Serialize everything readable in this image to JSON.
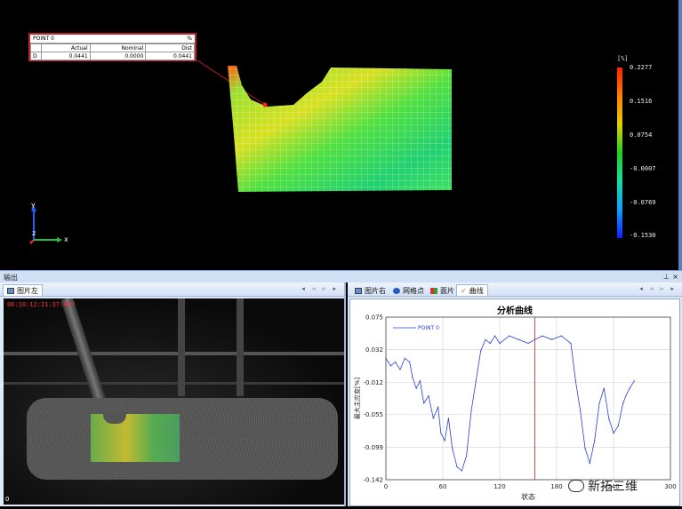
{
  "viewport": {
    "point_box": {
      "title": "POINT 0",
      "unit": "%",
      "headers": [
        "Actual",
        "Nominal",
        "Dist"
      ],
      "row_label": "D",
      "values": [
        "0.0441",
        "0.0000",
        "0.0441"
      ]
    },
    "scale": {
      "unit": "[%]",
      "ticks": [
        "0.2277",
        "0.1516",
        "0.0754",
        "-0.0007",
        "-0.0769",
        "-0.1530"
      ]
    },
    "axes": {
      "x": "x",
      "y": "y",
      "z": "z"
    }
  },
  "output_bar": {
    "title": "输出",
    "pin": "⊥",
    "close": "×"
  },
  "left_panel": {
    "tab": "图片左",
    "timestamp": "06:10:12:21:37:487",
    "frame_index": "0",
    "nav": "◂ ◃ ▹ ▸"
  },
  "right_panel": {
    "tabs": [
      "图片右",
      "网格点",
      "面片",
      "曲线"
    ],
    "nav": "◂ ◃ ▹ ▸",
    "watermark": "新拓三维"
  },
  "chart_data": {
    "type": "line",
    "title": "分析曲线",
    "xlabel": "状态",
    "ylabel": "最大主应变[%]",
    "xlim": [
      0,
      300
    ],
    "ylim": [
      -0.142,
      0.075
    ],
    "xticks": [
      0,
      60,
      120,
      180,
      240,
      300
    ],
    "yticks": [
      "0.075",
      "0.032",
      "-0.012",
      "-0.055",
      "-0.099",
      "-0.142"
    ],
    "marker_x": 157,
    "legend": "top-left",
    "series": [
      {
        "name": "POINT 0",
        "color": "#2a3fd6",
        "x": [
          0,
          5,
          10,
          15,
          20,
          25,
          28,
          32,
          36,
          40,
          45,
          50,
          55,
          58,
          62,
          66,
          70,
          75,
          80,
          85,
          90,
          95,
          100,
          105,
          110,
          115,
          120,
          130,
          140,
          150,
          157,
          165,
          175,
          185,
          195,
          200,
          205,
          210,
          215,
          220,
          225,
          230,
          235,
          240,
          245,
          250,
          253,
          257,
          262
        ],
        "y": [
          0.02,
          0.01,
          0.015,
          0.005,
          0.02,
          0.015,
          -0.005,
          -0.02,
          -0.01,
          -0.04,
          -0.03,
          -0.06,
          -0.045,
          -0.08,
          -0.09,
          -0.06,
          -0.1,
          -0.125,
          -0.13,
          -0.11,
          -0.05,
          -0.01,
          0.03,
          0.045,
          0.04,
          0.05,
          0.04,
          0.05,
          0.045,
          0.04,
          0.045,
          0.05,
          0.045,
          0.05,
          0.04,
          -0.01,
          -0.05,
          -0.1,
          -0.12,
          -0.09,
          -0.04,
          -0.02,
          -0.06,
          -0.08,
          -0.07,
          -0.04,
          -0.03,
          -0.02,
          -0.01
        ]
      }
    ]
  }
}
